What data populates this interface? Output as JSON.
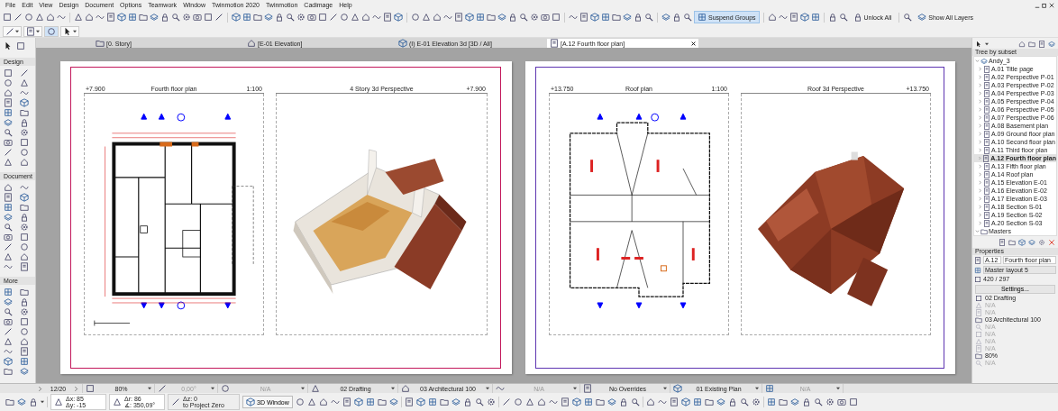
{
  "menu": [
    "File",
    "Edit",
    "View",
    "Design",
    "Document",
    "Options",
    "Teamwork",
    "Window",
    "Twinmotion 2020",
    "Twinmotion",
    "Cadimage",
    "Help"
  ],
  "toolbar": {
    "buttons": [
      {
        "label": "Suspend Groups",
        "selected": true
      },
      {
        "label": "Unlock All",
        "selected": false
      },
      {
        "label": "Show All Layers",
        "selected": false
      }
    ]
  },
  "tabs": [
    {
      "label": "[0. Story]",
      "kind": "story",
      "selected": false
    },
    {
      "label": "[E-01 Elevation]",
      "kind": "elevation",
      "selected": false
    },
    {
      "label": "(I) E-01 Elevation 3d [3D / All]",
      "kind": "model",
      "selected": false
    },
    {
      "label": "[A.12 Fourth floor plan]",
      "kind": "layout",
      "selected": true
    }
  ],
  "toolbox": {
    "sections": [
      "Design",
      "Document",
      "More"
    ]
  },
  "sheets": [
    {
      "color": "#c2185b",
      "views": [
        {
          "kind": "floor_plan",
          "elevation": "+7.900",
          "title": "Fourth floor plan",
          "scale": "1:100"
        },
        {
          "kind": "house_3d",
          "title": "4 Story 3d Perspective",
          "elevation": "+7.900"
        }
      ]
    },
    {
      "color": "#5e35b1",
      "views": [
        {
          "kind": "roof_plan",
          "elevation": "+13.750",
          "title": "Roof plan",
          "scale": "1:100"
        },
        {
          "kind": "roof_3d",
          "title": "Roof  3d Perspective",
          "elevation": "+13.750"
        }
      ]
    }
  ],
  "navigator": {
    "filter": "Tree by subset",
    "tree": [
      {
        "label": "Andy_3",
        "expanded": true,
        "children": [
          {
            "label": "A.01 Title page",
            "expanded": false,
            "selected": false
          },
          {
            "label": "A.02 Perspective P-01",
            "expanded": false,
            "selected": false
          },
          {
            "label": "A.03 Perspective P-02",
            "expanded": false,
            "selected": false
          },
          {
            "label": "A.04 Perspective P-03",
            "expanded": false,
            "selected": false
          },
          {
            "label": "A.05 Perspective P-04",
            "expanded": false,
            "selected": false
          },
          {
            "label": "A.06 Perspective P-05",
            "expanded": false,
            "selected": false
          },
          {
            "label": "A.07 Perspective P-06",
            "expanded": false,
            "selected": false
          },
          {
            "label": "A.08 Basement plan",
            "expanded": false,
            "selected": false
          },
          {
            "label": "A.09 Ground floor plan",
            "expanded": false,
            "selected": false
          },
          {
            "label": "A.10 Second floor plan",
            "expanded": false,
            "selected": false
          },
          {
            "label": "A.11 Third floor plan",
            "expanded": false,
            "selected": false
          },
          {
            "label": "A.12 Fourth floor plan",
            "expanded": false,
            "selected": true
          },
          {
            "label": "A.13 Fifth floor plan",
            "expanded": false,
            "selected": false
          },
          {
            "label": "A.14 Roof plan",
            "expanded": false,
            "selected": false
          },
          {
            "label": "A.15 Elevation E-01",
            "expanded": false,
            "selected": false
          },
          {
            "label": "A.16 Elevation E-02",
            "expanded": false,
            "selected": false
          },
          {
            "label": "A.17 Elevation E-03",
            "expanded": false,
            "selected": false
          },
          {
            "label": "A.18 Section S-01",
            "expanded": false,
            "selected": false
          },
          {
            "label": "A.19 Section S-02",
            "expanded": false,
            "selected": false
          },
          {
            "label": "A.20 Section S-03",
            "expanded": false,
            "selected": false
          }
        ]
      },
      {
        "label": "Masters",
        "expanded": true
      }
    ]
  },
  "properties": {
    "heading": "Properties",
    "id": "A.12",
    "name": "Fourth floor plan",
    "master": "Master layout 5",
    "size": "420 / 297",
    "settings_button": "Settings..."
  },
  "view_settings": [
    {
      "text": "02 Drafting",
      "disabled": false
    },
    {
      "text": "N/A",
      "disabled": true
    },
    {
      "text": "N/A",
      "disabled": true
    },
    {
      "text": "03 Architectural 100",
      "disabled": false
    },
    {
      "text": "N/A",
      "disabled": true
    },
    {
      "text": "N/A",
      "disabled": true
    },
    {
      "text": "N/A",
      "disabled": true
    },
    {
      "text": "N/A",
      "disabled": true
    },
    {
      "text": "80%",
      "disabled": false
    },
    {
      "text": "N/A",
      "disabled": true
    }
  ],
  "status_bar": {
    "page": "12/20",
    "fields": [
      {
        "text": "80%",
        "disabled": false
      },
      {
        "text": "0,00°",
        "disabled": true
      },
      {
        "text": "N/A",
        "disabled": true
      },
      {
        "text": "02 Drafting",
        "disabled": false
      },
      {
        "text": "03 Architectural 100",
        "disabled": false
      },
      {
        "text": "N/A",
        "disabled": true
      },
      {
        "text": "No Overrides",
        "disabled": false
      },
      {
        "text": "01 Existing Plan",
        "disabled": false
      },
      {
        "text": "N/A",
        "disabled": true
      }
    ],
    "dx": "Δx: 85",
    "dy": "Δy: -15",
    "dr": "Δr: 86",
    "angle": "∡: 350,09°",
    "dz": "Δz: 0",
    "reference": "to Project Zero",
    "window_button": "3D Window"
  }
}
